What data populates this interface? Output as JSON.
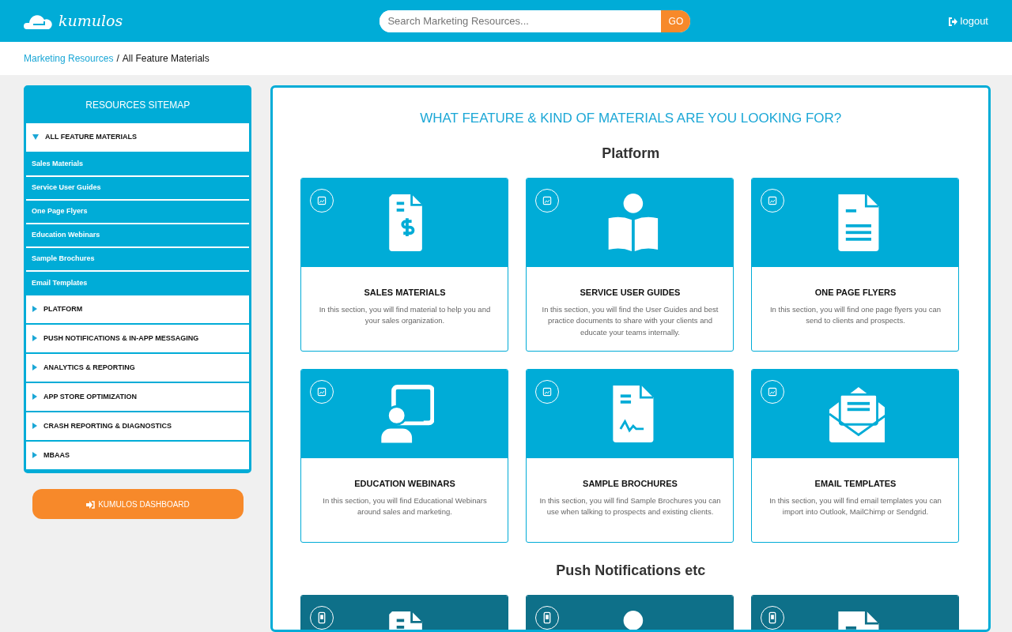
{
  "header": {
    "logo_text": "kumulos",
    "search": {
      "placeholder": "Search Marketing Resources...",
      "button": "GO"
    },
    "logout": "logout"
  },
  "breadcrumb": [
    {
      "label": "Marketing Resources",
      "link": true
    },
    {
      "label": "/",
      "link": false
    },
    {
      "label": "All Feature Materials",
      "link": false
    }
  ],
  "sidebar": {
    "title": "RESOURCES SITEMAP",
    "items": [
      {
        "label": "ALL FEATURE MATERIALS",
        "expanded": true,
        "children": [
          {
            "label": "Sales Materials"
          },
          {
            "label": "Service User Guides"
          },
          {
            "label": "One Page Flyers"
          },
          {
            "label": "Education Webinars"
          },
          {
            "label": "Sample Brochures"
          },
          {
            "label": "Email Templates"
          }
        ]
      },
      {
        "label": "PLATFORM",
        "expanded": false
      },
      {
        "label": "PUSH NOTIFICATIONS & IN-APP MESSAGING",
        "expanded": false
      },
      {
        "label": "ANALYTICS & REPORTING",
        "expanded": false
      },
      {
        "label": "APP STORE OPTIMIZATION",
        "expanded": false
      },
      {
        "label": "CRASH REPORTING & DIAGNOSTICS",
        "expanded": false
      },
      {
        "label": "MBAAS",
        "expanded": false
      }
    ],
    "dashboard_button": "KUMULOS DASHBOARD"
  },
  "main": {
    "heading": "WHAT FEATURE & KIND OF MATERIALS ARE YOU LOOKING FOR?",
    "sections": [
      {
        "title": "Platform",
        "color": "#00acd7",
        "kind": "image",
        "cards": [
          {
            "kind": "dollar-doc",
            "title": "SALES MATERIALS",
            "text": "In this section, you will find material to help you and your sales organization."
          },
          {
            "kind": "reader",
            "title": "SERVICE USER GUIDES",
            "text": "In this section, you will find the User Guides and best practice documents to share with your clients and educate your teams internally."
          },
          {
            "kind": "text-doc",
            "title": "ONE PAGE FLYERS",
            "text": "In this section, you will find one page flyers you can send to clients and prospects."
          },
          {
            "kind": "presenter",
            "title": "EDUCATION WEBINARS",
            "text": "In this section, you will find Educational Webinars around sales and marketing."
          },
          {
            "kind": "signed-doc",
            "title": "SAMPLE BROCHURES",
            "text": "In this section, you will find Sample Brochures you can use when talking to prospects and existing clients."
          },
          {
            "kind": "envelope",
            "title": "EMAIL TEMPLATES",
            "text": "In this section, you will find email templates you can import into Outlook, MailChimp or Sendgrid."
          }
        ]
      },
      {
        "title": "Push Notifications etc",
        "color": "#0e7089",
        "kind": "phone",
        "cards": [
          {
            "kind": "dollar-doc"
          },
          {
            "kind": "reader"
          },
          {
            "kind": "text-doc"
          }
        ]
      }
    ]
  }
}
